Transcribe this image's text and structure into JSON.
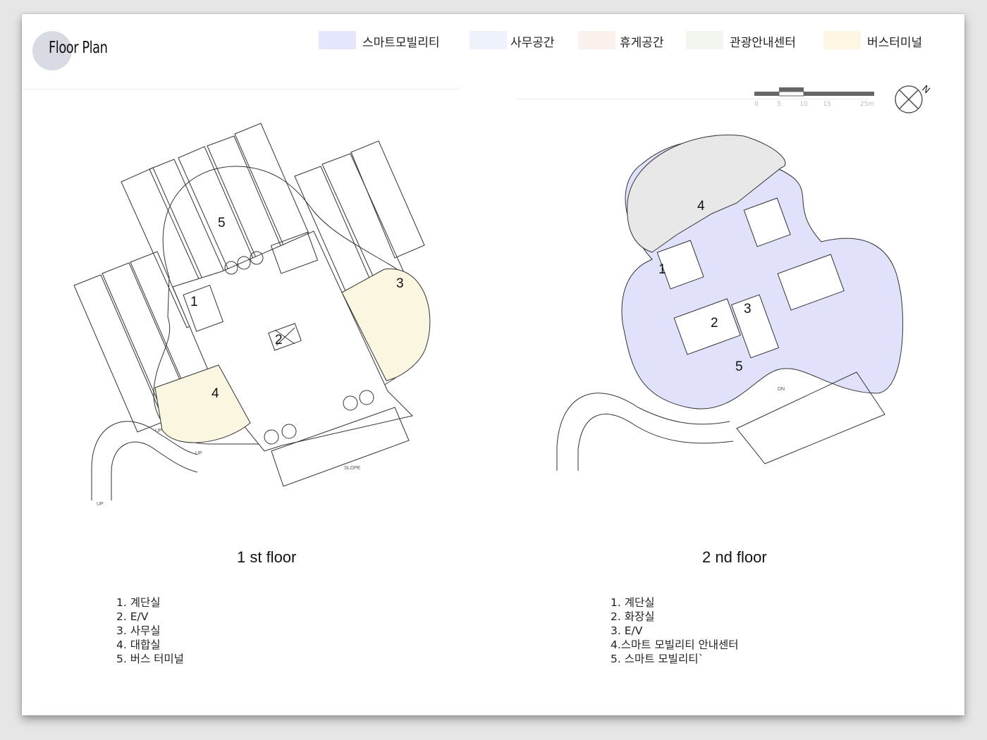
{
  "page_title": "Floor Plan",
  "legend": [
    {
      "label": "스마트모빌리티",
      "color": "#e3e6fc"
    },
    {
      "label": "사무공간",
      "color": "#eef2fb"
    },
    {
      "label": "휴게공간",
      "color": "#fbf1ec"
    },
    {
      "label": "관광안내센터",
      "color": "#f2f6ee"
    },
    {
      "label": "버스터미널",
      "color": "#fdf6e3"
    }
  ],
  "scale_bar": {
    "ticks": [
      "0",
      "5",
      "10",
      "15",
      "25m"
    ]
  },
  "north_label": "N",
  "floors": [
    {
      "caption": "1 st floor",
      "markers": [
        "1",
        "2",
        "3",
        "4",
        "5"
      ],
      "annotations": [
        "UP",
        "UP",
        "UP",
        "SLOPE"
      ],
      "rooms": [
        "1. 계단실",
        "2. E/V",
        "3. 사무실",
        "4. 대합실",
        "5. 버스 터미널"
      ]
    },
    {
      "caption": "2 nd floor",
      "markers": [
        "1",
        "2",
        "3",
        "4",
        "5"
      ],
      "annotations": [
        "DN"
      ],
      "rooms": [
        "1. 계단실",
        "2. 화장실",
        "3. E/V",
        "4.스마트 모빌리티 안내센터",
        "5. 스마트 모빌리티`"
      ]
    }
  ],
  "colors": {
    "smart_mobility_fill": "#dfe2fa",
    "info_center_fill": "#e8e8e8",
    "terminal_office_fill": "#fbf6e0",
    "line": "#333333"
  }
}
